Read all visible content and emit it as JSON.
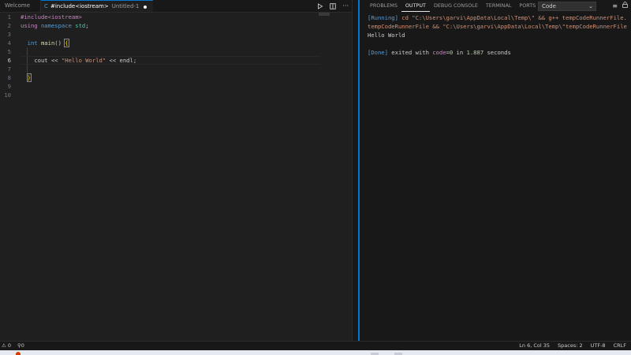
{
  "editor": {
    "tabs": [
      {
        "label": "Welcome",
        "active": false
      },
      {
        "label": "#include<iostream>",
        "description": "Untitled-1",
        "active": true,
        "dirty": true
      }
    ],
    "actions": [
      "run-icon",
      "split-editor-icon",
      "more-actions-icon"
    ],
    "line_numbers": [
      "1",
      "2",
      "3",
      "4",
      "5",
      "6",
      "7",
      "8",
      "9",
      "10"
    ],
    "current_line": 6,
    "code": {
      "l1_pre": "#include<iostream>",
      "l2_kw": "using",
      "l2_kw2": "namespace",
      "l2_ns": "std",
      "l2_semi": ";",
      "l4_kw": "int",
      "l4_fn": "main",
      "l4_paren": "()",
      "l4_brace": "{",
      "l6_cout": "cout",
      "l6_op1": "<<",
      "l6_str": "\"Hello World\"",
      "l6_op2": "<<",
      "l6_endl": "endl;",
      "l8_brace": "}"
    }
  },
  "panel": {
    "tabs": [
      "PROBLEMS",
      "OUTPUT",
      "DEBUG CONSOLE",
      "TERMINAL",
      "PORTS"
    ],
    "active_tab": "OUTPUT",
    "channel": "Code",
    "output": {
      "running_tag": "[Running]",
      "cmd_line1": " cd \"C:\\Users\\garvi\\AppData\\Local\\Temp\\\" && g++ tempCodeRunnerFile.",
      "cmd_line2": "tempCodeRunnerFile && \"C:\\Users\\garvi\\AppData\\Local\\Temp\\\"tempCodeRunnerFile",
      "program_output": "Hello World",
      "done_tag": "[Done]",
      "done_text1": " exited with ",
      "done_key": "code",
      "done_eq": "=",
      "done_code": "0",
      "done_text2": " in ",
      "done_time": "1.887",
      "done_text3": " seconds"
    }
  },
  "statusbar": {
    "errors": "⚠ 0",
    "ports": "0",
    "position": "Ln 6, Col 35",
    "spaces": "Spaces: 2",
    "encoding": "UTF-8",
    "eol": "CRLF"
  },
  "colors": {
    "accent": "#0078d4",
    "background": "#1f1f1f",
    "string": "#ce9178",
    "keyword": "#569cd6"
  }
}
